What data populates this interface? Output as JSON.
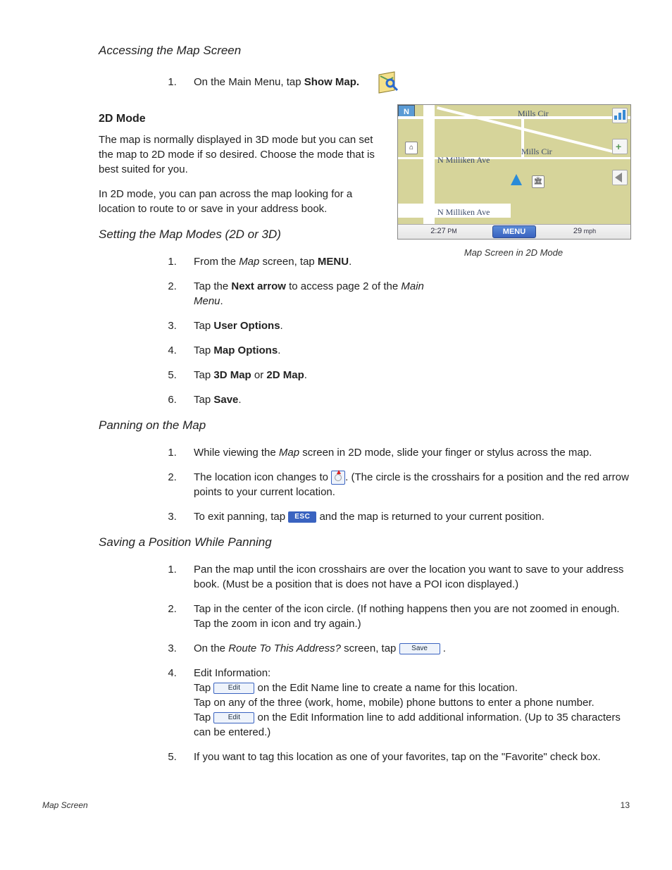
{
  "headings": {
    "accessing": "Accessing the Map Screen",
    "mode2d": "2D Mode",
    "setting": "Setting the Map Modes (2D or 3D)",
    "panning": "Panning on the Map",
    "saving": "Saving a Position While Panning"
  },
  "accessing": {
    "step1_pre": "On the Main Menu, tap ",
    "step1_bold": "Show Map."
  },
  "mode2d": {
    "p1": "The map is normally displayed in 3D mode but you can set the map to 2D mode if so desired.  Choose the mode that is best suited for you.",
    "p2": "In 2D mode, you can pan across the map looking for a location to route to or save in your address book."
  },
  "setting_steps": {
    "s1_pre": "From the ",
    "s1_ital": "Map",
    "s1_mid": " screen, tap ",
    "s1_bold": "MENU",
    "s1_post": ".",
    "s2_pre": "Tap the ",
    "s2_bold": "Next arrow",
    "s2_mid": " to access page 2 of the ",
    "s2_ital": "Main Menu",
    "s2_post": ".",
    "s3_pre": "Tap ",
    "s3_bold": "User Options",
    "s3_post": ".",
    "s4_pre": "Tap ",
    "s4_bold": "Map Options",
    "s4_post": ".",
    "s5_pre": "Tap ",
    "s5_bold1": "3D Map",
    "s5_mid": " or ",
    "s5_bold2": "2D Map",
    "s5_post": ".",
    "s6_pre": "Tap ",
    "s6_bold": "Save",
    "s6_post": "."
  },
  "panning_steps": {
    "s1_pre": "While viewing the ",
    "s1_ital": "Map",
    "s1_post": " screen in 2D mode, slide your finger or stylus across the map.",
    "s2_pre": " The location icon changes to ",
    "s2_post": ".  (The circle is the crosshairs for a position and the red arrow points to your current location.",
    "s3_pre": "To exit panning, tap ",
    "s3_post": " and the map is returned to your current position."
  },
  "saving_steps": {
    "s1": "Pan the map until the icon crosshairs are over the location you want to save to your address book.  (Must be a position that is does not have a POI icon displayed.)",
    "s2": "Tap in the center of the icon circle. (If nothing happens then you are not zoomed in enough.  Tap the zoom in icon and try again.)",
    "s3_pre": "On the ",
    "s3_ital": "Route To This Address?",
    "s3_mid": " screen, tap ",
    "s3_post": " .",
    "s4_title": "Edit Information:",
    "s4_line1_pre": "Tap ",
    "s4_line1_post": " on the Edit Name line to create a name for this location.",
    "s4_line2": "Tap on any of the three (work, home, mobile) phone buttons to enter a phone number.",
    "s4_line3_pre": "Tap ",
    "s4_line3_post": " on the Edit Information line to add additional information.  (Up to 35 characters can be entered.)",
    "s5": "If you want to tag this location as one of your favorites, tap on the \"Favorite\" check box."
  },
  "buttons": {
    "esc": "ESC",
    "save": "Save",
    "edit": "Edit"
  },
  "map": {
    "compass": "N",
    "street_top": "Mills Cir",
    "street_mid": "Mills Cir",
    "street_left1": "N Milliken Ave",
    "street_left2": "N Milliken Ave",
    "time": "2:27",
    "time_suffix": " PM",
    "menu": "MENU",
    "speed": "29",
    "speed_unit": " mph",
    "caption": "Map Screen in 2D Mode"
  },
  "footer": {
    "section": "Map Screen",
    "page": "13"
  }
}
